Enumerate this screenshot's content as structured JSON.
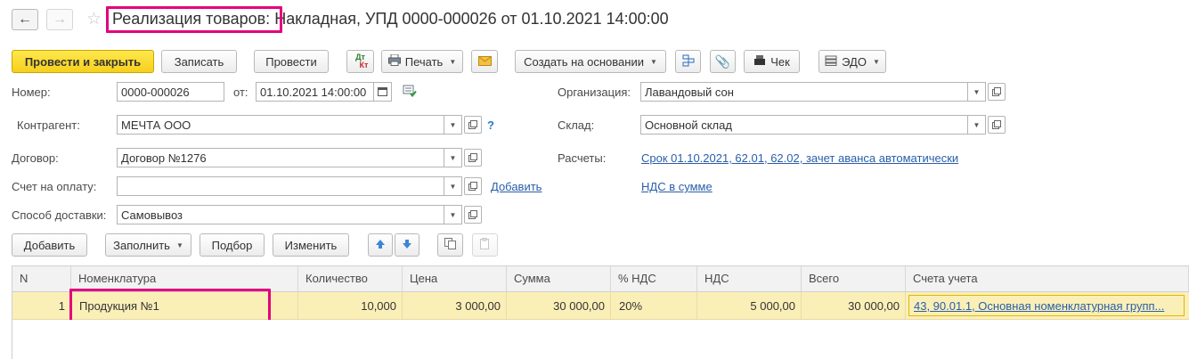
{
  "header": {
    "title_prefix": "Реализация товаров:",
    "title_rest": " Накладная, УПД 0000-000026 от 01.10.2021 14:00:00",
    "back_icon": "arrow-left-icon",
    "forward_icon": "arrow-right-icon",
    "favorite_icon": "star-icon"
  },
  "toolbar": {
    "post_close": "Провести и закрыть",
    "save": "Записать",
    "post": "Провести",
    "dt_kt_top": "Дт",
    "dt_kt_bottom": "Кт",
    "print": "Печать",
    "create_based": "Создать на основании",
    "receipt": "Чек",
    "edo": "ЭДО"
  },
  "form": {
    "number_label": "Номер:",
    "number_value": "0000-000026",
    "date_label": "от:",
    "date_value": "01.10.2021 14:00:00",
    "org_label": "Организация:",
    "org_value": "Лавандовый сон",
    "contractor_label": "Контрагент:",
    "contractor_value": "МЕЧТА ООО",
    "help_mark": "?",
    "warehouse_label": "Склад:",
    "warehouse_value": "Основной склад",
    "contract_label": "Договор:",
    "contract_value": "Договор №1276",
    "settlements_label": "Расчеты:",
    "settlements_link": "Срок 01.10.2021, 62.01, 62.02, зачет аванса автоматически",
    "invoice_label": "Счет на оплату:",
    "invoice_value": "",
    "invoice_add_link": "Добавить",
    "vat_link": "НДС в сумме",
    "delivery_label": "Способ доставки:",
    "delivery_value": "Самовывоз"
  },
  "table_toolbar": {
    "add": "Добавить",
    "fill": "Заполнить",
    "pick": "Подбор",
    "change": "Изменить"
  },
  "table": {
    "columns": [
      "N",
      "Номенклатура",
      "Количество",
      "Цена",
      "Сумма",
      "% НДС",
      "НДС",
      "Всего",
      "Счета учета"
    ],
    "rows": [
      {
        "n": "1",
        "item": "Продукция №1",
        "qty": "10,000",
        "price": "3 000,00",
        "sum": "30 000,00",
        "vat_rate": "20%",
        "vat": "5 000,00",
        "total": "30 000,00",
        "accounts": "43, 90.01.1, Основная номенклатурная групп..."
      }
    ]
  },
  "colors": {
    "highlight": "#e4007c",
    "primary_button": "#f6cf1c",
    "selected_row": "#fbefb8",
    "link": "#2a5ea8"
  }
}
